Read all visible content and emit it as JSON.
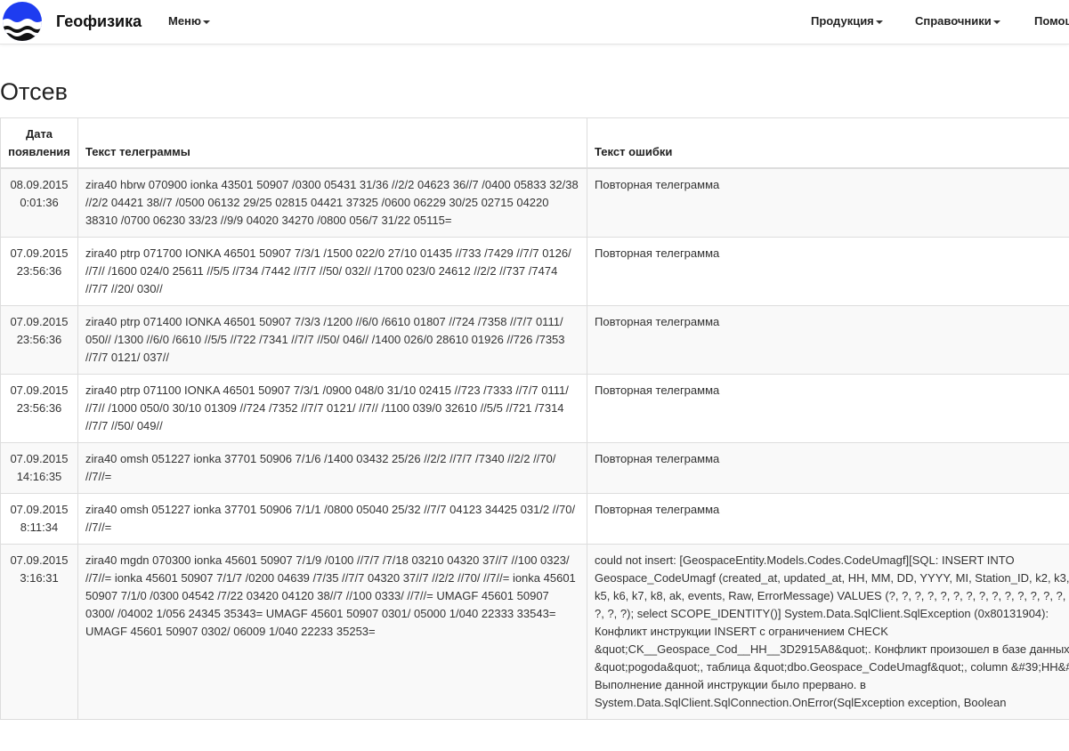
{
  "nav": {
    "brand": "Геофизика",
    "menu_label": "Меню",
    "right_items": [
      "Продукция",
      "Справочники",
      "Помощь"
    ]
  },
  "page": {
    "title": "Отсев"
  },
  "table": {
    "headers": [
      "Дата появления",
      "Текст телеграммы",
      "Текст ошибки"
    ],
    "rows": [
      {
        "date": "08.09.2015 0:01:36",
        "telegram": "zira40 hbrw 070900 ionka 43501 50907 /0300 05431 31/36 //2/2 04623 36//7 /0400 05833 32/38 //2/2 04421 38//7 /0500 06132 29/25 02815 04421 37325 /0600 06229 30/25 02715 04220 38310 /0700 06230 33/23 //9/9 04020 34270 /0800 056/7 31/22 05115=",
        "error": "Повторная телеграмма"
      },
      {
        "date": "07.09.2015 23:56:36",
        "telegram": "zira40 ptrp 071700 IONKA 46501 50907 7/3/1 /1500 022/0 27/10 01435 //733 /7429 //7/7 0126/ //7// /1600 024/0 25611 //5/5 //734 /7442 //7/7 //50/ 032// /1700 023/0 24612 //2/2 //737 /7474 //7/7 //20/ 030//",
        "error": "Повторная телеграмма"
      },
      {
        "date": "07.09.2015 23:56:36",
        "telegram": "zira40 ptrp 071400 IONKA 46501 50907 7/3/3 /1200 //6/0 /6610 01807 //724 /7358 //7/7 0111/ 050// /1300 //6/0 /6610 //5/5 //722 /7341 //7/7 //50/ 046// /1400 026/0 28610 01926 //726 /7353 //7/7 0121/ 037//",
        "error": "Повторная телеграмма"
      },
      {
        "date": "07.09.2015 23:56:36",
        "telegram": "zira40 ptrp 071100 IONKA 46501 50907 7/3/1 /0900 048/0 31/10 02415 //723 /7333 //7/7 0111/ //7// /1000 050/0 30/10 01309 //724 /7352 //7/7 0121/ //7// /1100 039/0 32610 //5/5 //721 /7314 //7/7 //50/ 049//",
        "error": "Повторная телеграмма"
      },
      {
        "date": "07.09.2015 14:16:35",
        "telegram": "zira40 omsh 051227 ionka 37701 50906 7/1/6 /1400 03432 25/26 //2/2 //7/7 /7340 //2/2 //70/ //7//=",
        "error": "Повторная телеграмма"
      },
      {
        "date": "07.09.2015 8:11:34",
        "telegram": "zira40 omsh 051227 ionka 37701 50906 7/1/1 /0800 05040 25/32 //7/7 04123 34425 031/2 //70/ //7//=",
        "error": "Повторная телеграмма"
      },
      {
        "date": "07.09.2015 3:16:31",
        "telegram": "zira40 mgdn 070300 ionka 45601 50907 7/1/9 /0100 //7/7 /7/18 03210 04320 37//7 //100 0323/ //7//= ionka 45601 50907 7/1/7 /0200 04639 /7/35 //7/7 04320 37//7 //2/2 //70/ //7//= ionka 45601 50907 7/1/0 /0300 04542 /7/22 03420 04120 38//7 //100 0333/ //7//= UMAGF 45601 50907 0300/ /04002 1/056 24345 35343= UMAGF 45601 50907 0301/ 05000 1/040 22333 33543= UMAGF 45601 50907 0302/ 06009 1/040 22233 35253=",
        "error": "could not insert: [GeospaceEntity.Models.Codes.CodeUmagf][SQL: INSERT INTO Geospace_CodeUmagf (created_at, updated_at, HH, MM, DD, YYYY, MI, Station_ID, k2, k3, k4, k5, k6, k7, k8, ak, events, Raw, ErrorMessage) VALUES (?, ?, ?, ?, ?, ?, ?, ?, ?, ?, ?, ?, ?, ?, ?, ?, ?, ?, ?); select SCOPE_IDENTITY()] System.Data.SqlClient.SqlException (0x80131904): Конфликт инструкции INSERT с ограничением CHECK &quot;CK__Geospace_Cod__HH__3D2915A8&quot;. Конфликт произошел в базе данных &quot;pogoda&quot;, таблица &quot;dbo.Geospace_CodeUmagf&quot;, column &#39;HH&#39;. Выполнение данной инструкции было прервано. в System.Data.SqlClient.SqlConnection.OnError(SqlException exception, Boolean"
      }
    ]
  }
}
